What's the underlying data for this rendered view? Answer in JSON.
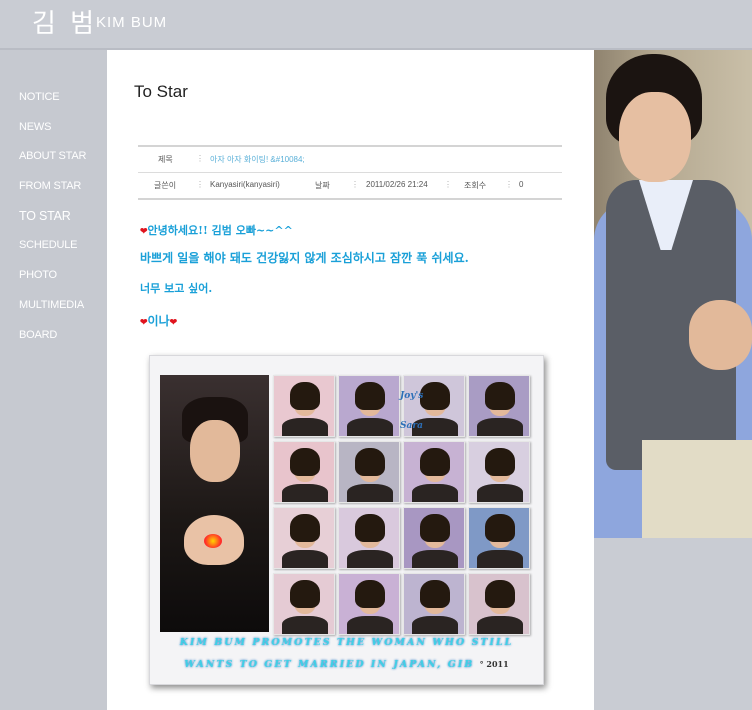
{
  "header": {
    "logo_korean": "김 범",
    "logo_english": "KIM BUM"
  },
  "nav": {
    "items": [
      "NOTICE",
      "NEWS",
      "ABOUT STAR",
      "FROM STAR",
      "TO STAR",
      "SCHEDULE",
      "PHOTO",
      "MULTIMEDIA",
      "BOARD"
    ],
    "active": "TO STAR"
  },
  "page": {
    "title": "To Star"
  },
  "post": {
    "title_label": "제목",
    "title_value": "아자 아자 화이팅! &#10084;",
    "author_label": "글쓴이",
    "author_value": "Kanyasiri(kanyasiri)",
    "date_label": "날짜",
    "date_value": "2011/02/26 21:24",
    "views_label": "조회수",
    "views_value": "0"
  },
  "message": {
    "line1": "안녕하세요!! 김범 오빠~~^^",
    "line2": "바쁘게 일을 해야 돼도 건강잃지 않게 조심하시고 잠깐 푹 쉬세요.",
    "line3": "너무 보고 싶어.",
    "signature": "이나"
  },
  "collage": {
    "vertical_text": "Joy's Sara",
    "caption_line1": "KIM BUM PROMOTES THE WOMAN WHO STILL",
    "caption_line2": "WANTS TO GET MARRIED IN JAPAN, GIB",
    "caption_year": "° 2011"
  },
  "colors": {
    "accent": "#1aa0d8",
    "heart": "#e0141e",
    "sidebar": "#c6c9d0"
  }
}
